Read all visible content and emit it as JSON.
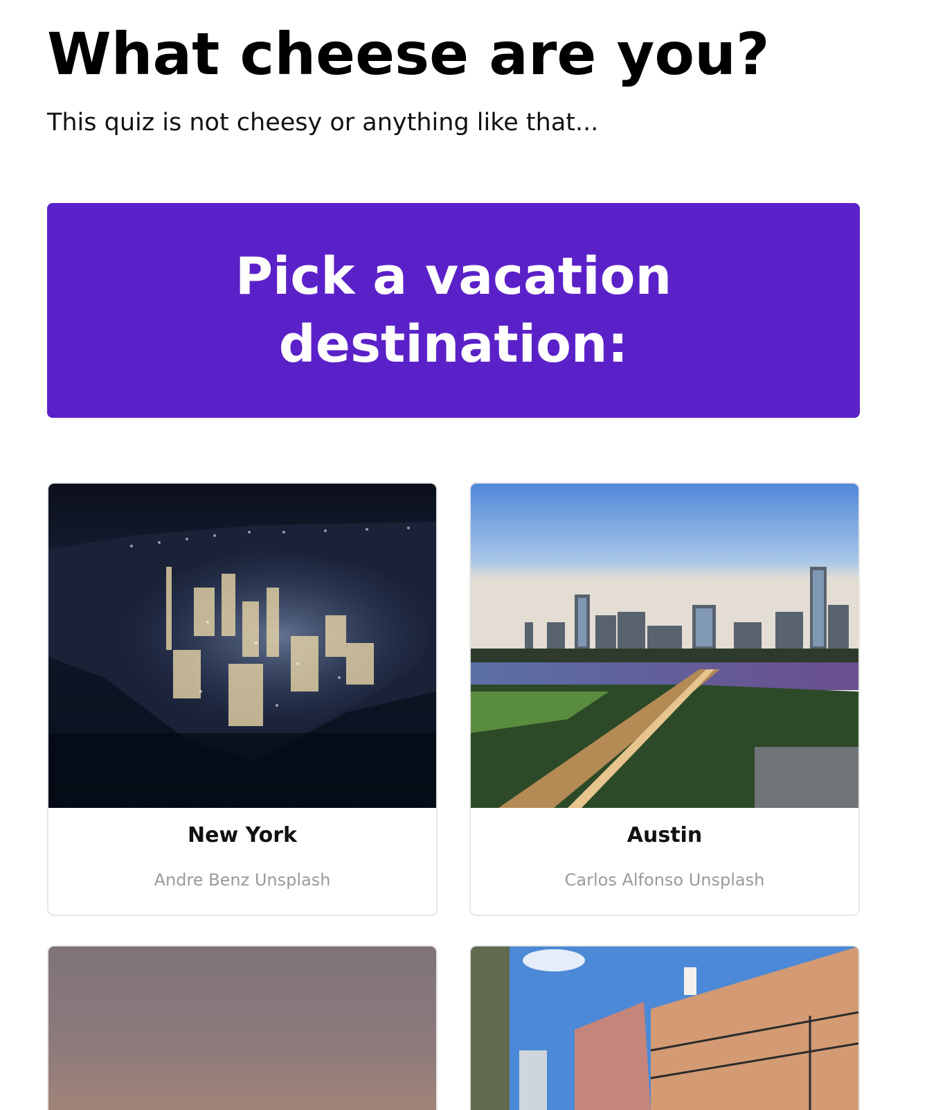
{
  "header": {
    "title": "What cheese are you?",
    "subtitle": "This quiz is not cheesy or anything like that..."
  },
  "question": {
    "text": "Pick a vacation destination:",
    "color": "#5b21c8"
  },
  "options": [
    {
      "label": "New York",
      "credit": "Andre Benz Unsplash"
    },
    {
      "label": "Austin",
      "credit": "Carlos Alfonso Unsplash"
    },
    {
      "label": "",
      "credit": ""
    },
    {
      "label": "",
      "credit": ""
    }
  ]
}
